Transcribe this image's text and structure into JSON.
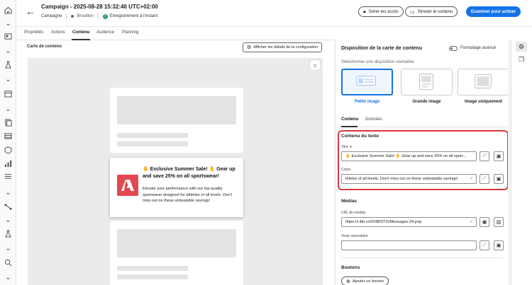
{
  "header": {
    "title": "Campaign - 2025-08-28 15:32:46 UTC+02:00",
    "campaign_label": "Campagne",
    "status": "Brouillon",
    "save_status": "Enregistrement à l'instant",
    "manage_access": "Gérer les accès",
    "simulate": "Simuler le contenu",
    "review": "Examiner pour activer"
  },
  "tabs": [
    "Propriétés",
    "Actions",
    "Contenu",
    "Audience",
    "Planning"
  ],
  "active_tab": "Contenu",
  "canvas": {
    "label": "Carte de contenu",
    "details_button": "Afficher les détails de la configuration",
    "message": {
      "title": "✋ Exclusive Summer Sale! ✋ Gear up and save 25% on all sportswear!",
      "body": "Elevate your performance with our top-quality sportswear designed for athletes of all levels. Don't miss out on these unbeatable savings!"
    }
  },
  "panel": {
    "title": "Disposition de la carte de contenu",
    "advanced_toggle": "Formatage avancé",
    "hint": "Sélectionner une disposition souhaitée",
    "layouts": [
      "Petite image",
      "Grande image",
      "Image uniquement"
    ],
    "selected_layout": "Petite image",
    "sub_tabs": [
      "Contenu",
      "Données"
    ],
    "text_section": "Contenu du texte",
    "title_label": "Titre ∗",
    "title_value": "✋ Exclusive Summer Sale! ✋ Gear up and save 25% on all sport...",
    "body_label": "Corps",
    "body_value": "thletes of all levels. Don't miss out on these unbeatable savings!",
    "media_section": "Médias",
    "media_url_label": "URL de médias",
    "media_url_value": "https://i.ibb.co/0X8R3TG/Messages-24.png",
    "secondary_text_label": "Texte secondaire",
    "secondary_text_value": "",
    "buttons_section": "Boutons",
    "add_button": "Ajouter un bouton"
  },
  "colors": {
    "accent": "#1473e6",
    "highlight": "#d7373f",
    "success": "#2d9d78",
    "logo": "#e34850"
  }
}
